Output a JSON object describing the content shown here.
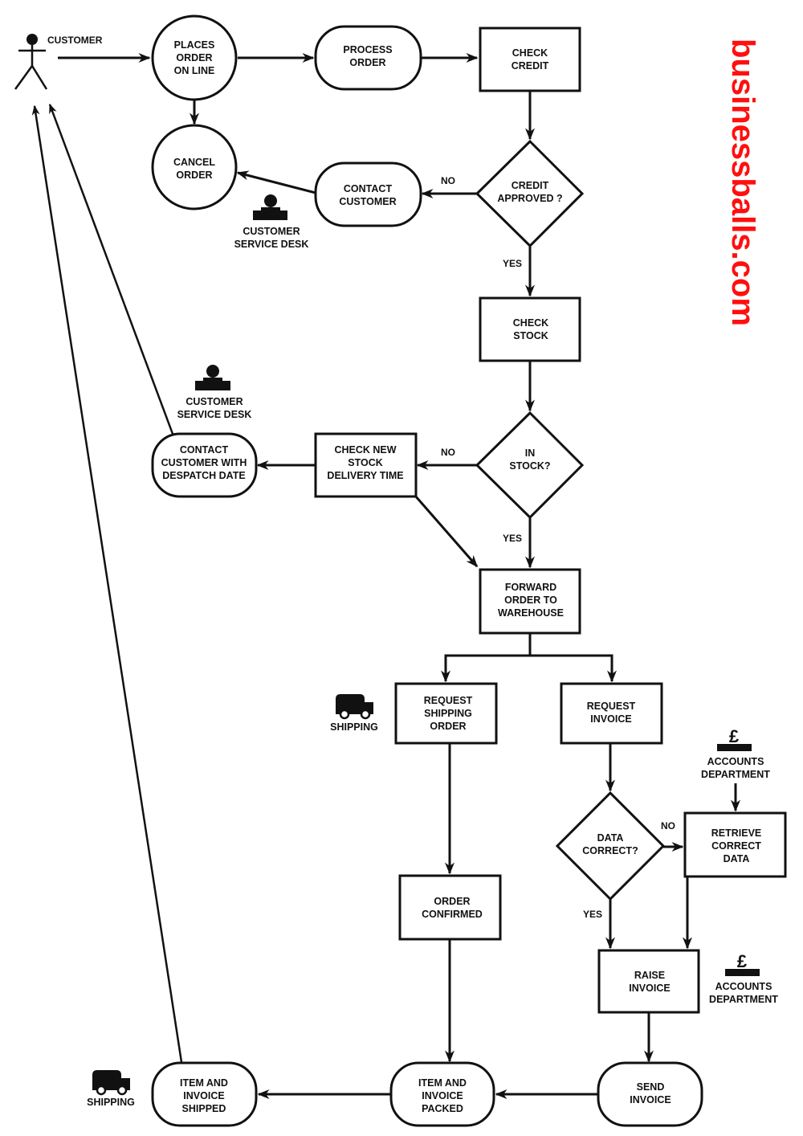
{
  "brand": {
    "text": "businessballs.com",
    "color": "#ff0f0f"
  },
  "actor": {
    "label": "CUSTOMER",
    "icon": "stick-figure-icon"
  },
  "nodes": {
    "places_order": {
      "shape": "circle",
      "lines": [
        "PLACES",
        "ORDER",
        "ON LINE"
      ]
    },
    "cancel_order": {
      "shape": "circle",
      "lines": [
        "CANCEL",
        "ORDER"
      ]
    },
    "process_order": {
      "shape": "rounded",
      "lines": [
        "PROCESS",
        "ORDER"
      ]
    },
    "check_credit": {
      "shape": "rect",
      "lines": [
        "CHECK",
        "CREDIT"
      ]
    },
    "credit_approved": {
      "shape": "diamond",
      "lines": [
        "CREDIT",
        "APPROVED ?"
      ]
    },
    "contact_customer": {
      "shape": "rounded",
      "lines": [
        "CONTACT",
        "CUSTOMER"
      ]
    },
    "check_stock": {
      "shape": "rect",
      "lines": [
        "CHECK",
        "STOCK"
      ]
    },
    "in_stock": {
      "shape": "diamond",
      "lines": [
        "IN",
        "STOCK?"
      ]
    },
    "check_new_stock": {
      "shape": "rect",
      "lines": [
        "CHECK NEW",
        "STOCK",
        "DELIVERY TIME"
      ]
    },
    "contact_despatch": {
      "shape": "rounded",
      "lines": [
        "CONTACT",
        "CUSTOMER WITH",
        "DESPATCH DATE"
      ]
    },
    "forward_order": {
      "shape": "rect",
      "lines": [
        "FORWARD",
        "ORDER TO",
        "WAREHOUSE"
      ]
    },
    "request_shipping": {
      "shape": "rect",
      "lines": [
        "REQUEST",
        "SHIPPING",
        "ORDER"
      ]
    },
    "request_invoice": {
      "shape": "rect",
      "lines": [
        "REQUEST",
        "INVOICE"
      ]
    },
    "data_correct": {
      "shape": "diamond",
      "lines": [
        "DATA",
        "CORRECT?"
      ]
    },
    "retrieve_data": {
      "shape": "rect",
      "lines": [
        "RETRIEVE",
        "CORRECT",
        "DATA"
      ]
    },
    "order_confirmed": {
      "shape": "rect",
      "lines": [
        "ORDER",
        "CONFIRMED"
      ]
    },
    "raise_invoice": {
      "shape": "rect",
      "lines": [
        "RAISE",
        "INVOICE"
      ]
    },
    "send_invoice": {
      "shape": "rounded",
      "lines": [
        "SEND",
        "INVOICE"
      ]
    },
    "item_packed": {
      "shape": "rounded",
      "lines": [
        "ITEM AND",
        "INVOICE",
        "PACKED"
      ]
    },
    "item_shipped": {
      "shape": "rounded",
      "lines": [
        "ITEM AND",
        "INVOICE",
        "SHIPPED"
      ]
    }
  },
  "edge_labels": {
    "credit_no": "NO",
    "credit_yes": "YES",
    "stock_no": "NO",
    "stock_yes": "YES",
    "data_no": "NO",
    "data_yes": "YES"
  },
  "annotations": {
    "csd_1": {
      "icon": "service-desk-icon",
      "lines": [
        "CUSTOMER",
        "SERVICE DESK"
      ]
    },
    "csd_2": {
      "icon": "service-desk-icon",
      "lines": [
        "CUSTOMER",
        "SERVICE DESK"
      ]
    },
    "shipping_1": {
      "icon": "truck-icon",
      "lines": [
        "SHIPPING"
      ]
    },
    "shipping_2": {
      "icon": "truck-icon",
      "lines": [
        "SHIPPING"
      ]
    },
    "accounts_1": {
      "icon": "pound-sign-icon",
      "lines": [
        "ACCOUNTS",
        "DEPARTMENT"
      ]
    },
    "accounts_2": {
      "icon": "pound-sign-icon",
      "lines": [
        "ACCOUNTS",
        "DEPARTMENT"
      ]
    }
  },
  "edges": [
    [
      "customer",
      "places_order"
    ],
    [
      "places_order",
      "process_order"
    ],
    [
      "places_order",
      "cancel_order"
    ],
    [
      "process_order",
      "check_credit"
    ],
    [
      "check_credit",
      "credit_approved"
    ],
    [
      "credit_approved",
      "contact_customer",
      "NO"
    ],
    [
      "contact_customer",
      "cancel_order"
    ],
    [
      "credit_approved",
      "check_stock",
      "YES"
    ],
    [
      "check_stock",
      "in_stock"
    ],
    [
      "in_stock",
      "check_new_stock",
      "NO"
    ],
    [
      "check_new_stock",
      "contact_despatch"
    ],
    [
      "check_new_stock",
      "forward_order"
    ],
    [
      "in_stock",
      "forward_order",
      "YES"
    ],
    [
      "contact_despatch",
      "customer"
    ],
    [
      "forward_order",
      "request_shipping"
    ],
    [
      "forward_order",
      "request_invoice"
    ],
    [
      "request_shipping",
      "order_confirmed"
    ],
    [
      "request_invoice",
      "data_correct"
    ],
    [
      "data_correct",
      "retrieve_data",
      "NO"
    ],
    [
      "data_correct",
      "raise_invoice",
      "YES"
    ],
    [
      "retrieve_data",
      "raise_invoice"
    ],
    [
      "accounts_1",
      "retrieve_data"
    ],
    [
      "order_confirmed",
      "item_packed"
    ],
    [
      "raise_invoice",
      "send_invoice"
    ],
    [
      "send_invoice",
      "item_packed"
    ],
    [
      "item_packed",
      "item_shipped"
    ],
    [
      "item_shipped",
      "customer"
    ]
  ]
}
